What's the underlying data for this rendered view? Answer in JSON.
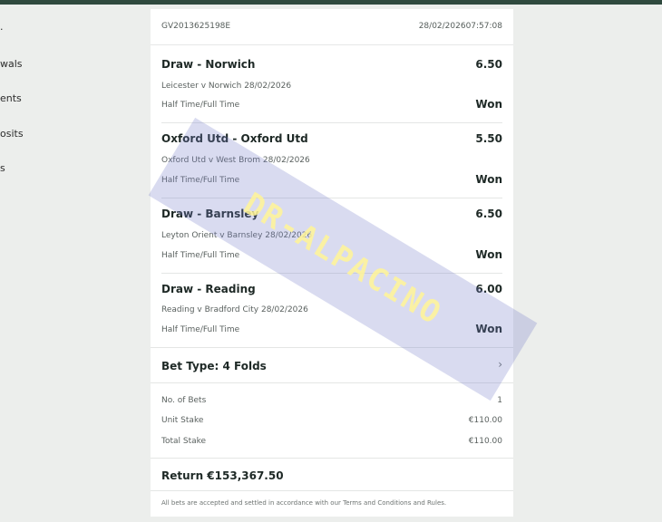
{
  "sidebar": {
    "items": [
      {
        "label": "."
      },
      {
        "label": "wals"
      },
      {
        "label": "ents"
      },
      {
        "label": "osits"
      },
      {
        "label": "s"
      }
    ]
  },
  "receipt": {
    "bet_id": "GV2013625198E",
    "datetime": "28/02/202607:57:08",
    "selections": [
      {
        "title": "Draw - Norwich",
        "odds": "6.50",
        "match": "Leicester v Norwich 28/02/2026",
        "market": "Half Time/Full Time",
        "result": "Won"
      },
      {
        "title": "Oxford Utd - Oxford Utd",
        "odds": "5.50",
        "match": "Oxford Utd v West Brom 28/02/2026",
        "market": "Half Time/Full Time",
        "result": "Won"
      },
      {
        "title": "Draw - Barnsley",
        "odds": "6.50",
        "match": "Leyton Orient v Barnsley 28/02/2026",
        "market": "Half Time/Full Time",
        "result": "Won"
      },
      {
        "title": "Draw - Reading",
        "odds": "6.00",
        "match": "Reading v Bradford City 28/02/2026",
        "market": "Half Time/Full Time",
        "result": "Won"
      }
    ],
    "bet_type": "Bet Type: 4 Folds",
    "chevron": "›",
    "summary": {
      "no_of_bets_label": "No. of Bets",
      "no_of_bets": "1",
      "unit_stake_label": "Unit Stake",
      "unit_stake": "€110.00",
      "total_stake_label": "Total Stake",
      "total_stake": "€110.00"
    },
    "return_text": "Return €153,367.50",
    "footer": "All bets are accepted and settled in accordance with our Terms and Conditions and Rules."
  },
  "watermark": {
    "text": "DR-ALPACINO"
  }
}
